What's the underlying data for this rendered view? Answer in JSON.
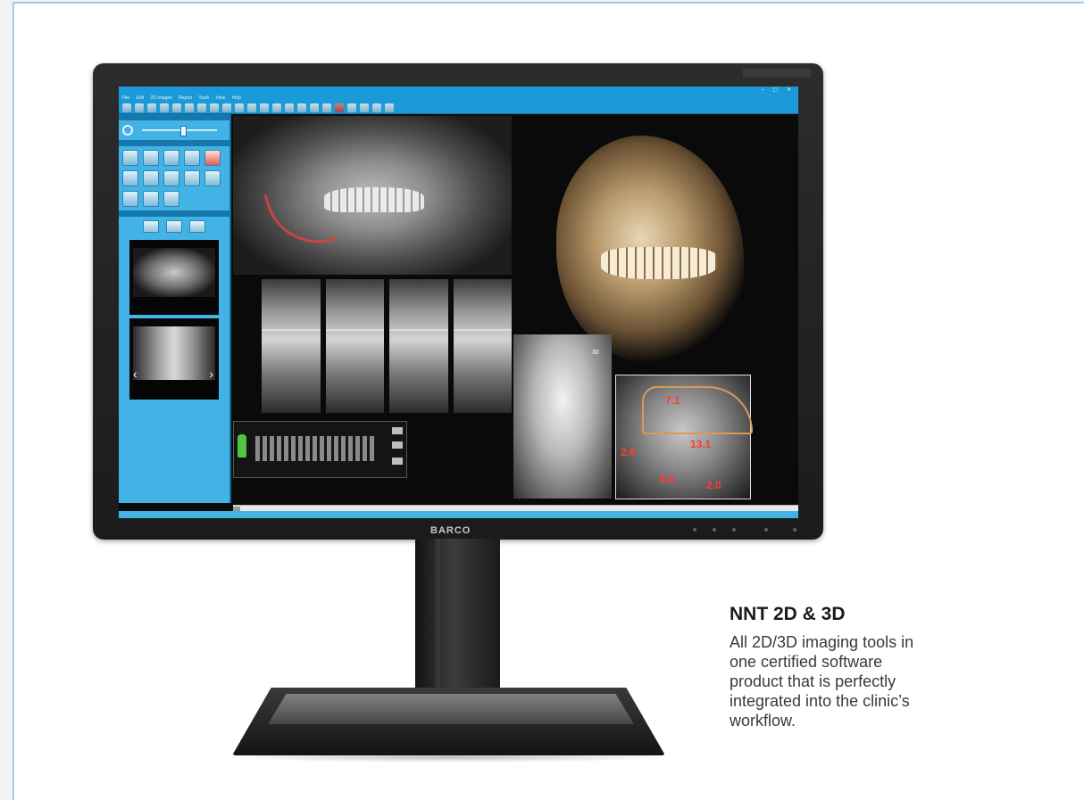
{
  "caption": {
    "title": "NNT 2D & 3D",
    "body": "All 2D/3D imaging tools in one certified software product that is perfectly integrated into the clinic’s workflow."
  },
  "monitor": {
    "logo": "BARCO"
  },
  "app": {
    "menu": [
      "File",
      "Edit",
      "2D Images",
      "Report",
      "Tools",
      "View",
      "Help"
    ],
    "measurements": [
      "7.1",
      "2.6",
      "13.1",
      "6.6",
      "2.0"
    ],
    "pa_label": "30"
  },
  "colors": {
    "app_blue": "#1a9ad6",
    "panel_blue": "#43b3e6",
    "measure_red": "#ff3b2f"
  }
}
